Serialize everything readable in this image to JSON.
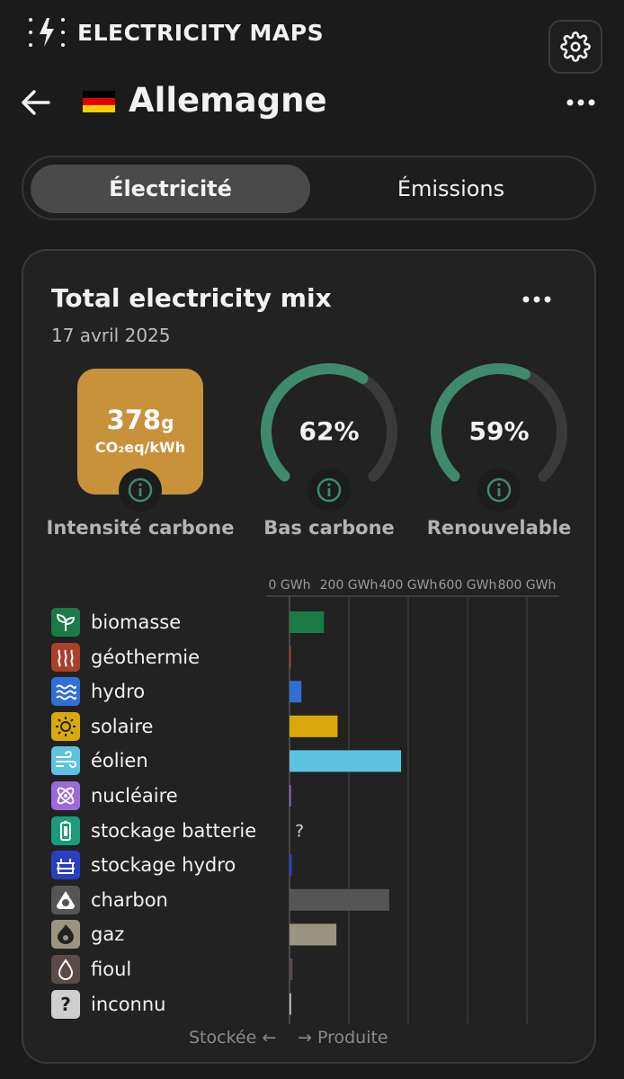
{
  "app": {
    "title": "ELECTRICITY MAPS"
  },
  "header": {
    "zone_name": "Allemagne"
  },
  "tabs": {
    "electricity": "Électricité",
    "emissions": "Émissions"
  },
  "card": {
    "title": "Total electricity mix",
    "date": "17 avril 2025"
  },
  "metrics": {
    "carbon_intensity": {
      "value": "378",
      "unit_g": "g",
      "unit": "CO₂eq/kWh",
      "label": "Intensité carbone"
    },
    "low_carbon": {
      "value": "62%",
      "percent": 62,
      "label": "Bas carbone"
    },
    "renewable": {
      "value": "59%",
      "percent": 59,
      "label": "Renouvelable"
    }
  },
  "footer": {
    "stored": "Stockée ←",
    "produced": "→ Produite"
  },
  "colors": {
    "accent_gauge": "#3f8a6c",
    "gauge_track": "#3a3a3a",
    "carbon_box": "#c8923a"
  },
  "chart_data": {
    "type": "bar",
    "orientation": "horizontal",
    "x_ticks": [
      "0 GWh",
      "200 GWh",
      "400 GWh",
      "600 GWh",
      "800 GWh"
    ],
    "xlim": [
      0,
      900
    ],
    "categories": [
      "biomasse",
      "géothermie",
      "hydro",
      "solaire",
      "éolien",
      "nucléaire",
      "stockage batterie",
      "stockage hydro",
      "charbon",
      "gaz",
      "fioul",
      "inconnu"
    ],
    "values": [
      116,
      2,
      40,
      162,
      376,
      0,
      null,
      8,
      336,
      158,
      10,
      5
    ],
    "colors": [
      "#1b7a46",
      "#a8402a",
      "#2f6fd6",
      "#d9a90c",
      "#5dc3e0",
      "#9c6ad9",
      "#1a9c7c",
      "#2a3fc0",
      "#555555",
      "#9b9481",
      "#5a4a48",
      "#cfcfcf"
    ],
    "icons": [
      "sprout-icon",
      "geothermal-icon",
      "water-icon",
      "sun-icon",
      "wind-icon",
      "atom-icon",
      "battery-icon",
      "dam-icon",
      "coal-icon",
      "flame-icon",
      "oil-drop-icon",
      "question-icon"
    ],
    "unknown_marker": "?"
  }
}
